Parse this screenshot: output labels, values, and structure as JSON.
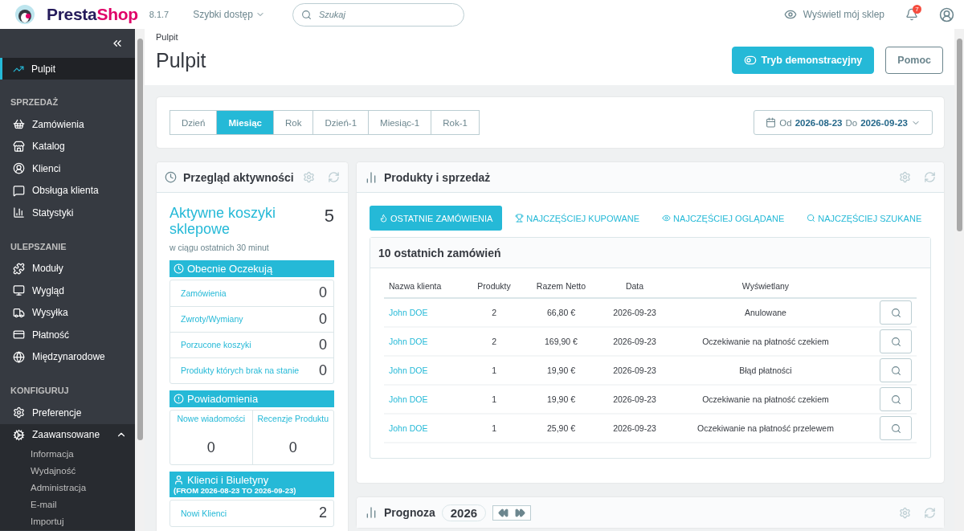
{
  "header": {
    "logo": {
      "part_1": "Presta",
      "part_2": "Shop"
    },
    "version": "8.1.7",
    "quick_access": "Szybki dostęp",
    "search": {
      "placeholder": "Szukaj"
    },
    "view_shop": "Wyświetl mój sklep",
    "notifications": "7"
  },
  "sidebar": {
    "top": {
      "label": "Pulpit",
      "selected": true
    },
    "sections": [
      {
        "title": "SPRZEDAŻ",
        "items": [
          {
            "label": "Zamówienia",
            "selected": false,
            "expanded": false
          },
          {
            "label": "Katalog",
            "selected": false,
            "expanded": false
          },
          {
            "label": "Klienci",
            "selected": false,
            "expanded": false
          },
          {
            "label": "Obsługa klienta",
            "selected": false,
            "expanded": false
          },
          {
            "label": "Statystyki",
            "selected": false,
            "expanded": false
          }
        ]
      },
      {
        "title": "ULEPSZANIE",
        "items": [
          {
            "label": "Moduły",
            "selected": false,
            "expanded": false
          },
          {
            "label": "Wygląd",
            "selected": false,
            "expanded": false
          },
          {
            "label": "Wysyłka",
            "selected": false,
            "expanded": false
          },
          {
            "label": "Płatność",
            "selected": false,
            "expanded": false
          },
          {
            "label": "Międzynarodowe",
            "selected": false,
            "expanded": false
          }
        ]
      },
      {
        "title": "KONFIGURUJ",
        "items": [
          {
            "label": "Preferencje",
            "selected": false,
            "expanded": false
          },
          {
            "label": "Zaawansowane",
            "selected": false,
            "expanded": true,
            "children": [
              {
                "label": "Informacja",
                "selected": false
              },
              {
                "label": "Wydajność",
                "selected": false
              },
              {
                "label": "Administracja",
                "selected": false
              },
              {
                "label": "E-mail",
                "selected": false
              },
              {
                "label": "Importuj",
                "selected": false
              }
            ]
          }
        ]
      }
    ]
  },
  "page": {
    "breadcrumb": "Pulpit",
    "title": "Pulpit",
    "buttons": [
      {
        "label": "Tryb demonstracyjny",
        "kind": "primary"
      },
      {
        "label": "Pomoc",
        "kind": "outline"
      }
    ]
  },
  "periods": [
    {
      "label": "Dzień",
      "selected": false
    },
    {
      "label": "Miesiąc",
      "selected": true
    },
    {
      "label": "Rok",
      "selected": false
    },
    {
      "label": "Dzień-1",
      "selected": false
    },
    {
      "label": "Miesiąc-1",
      "selected": false
    },
    {
      "label": "Rok-1",
      "selected": false
    }
  ],
  "date_range": {
    "from_label": "Od",
    "from": "2026-08-23",
    "to_label": "Do",
    "to": "2026-09-23"
  },
  "activity": {
    "title": "Przegląd aktywności",
    "carts_label": "Aktywne koszyki sklepowe",
    "carts_value": "5",
    "carts_note": "w ciągu ostatnich 30 minut",
    "sections": [
      {
        "kind": "list",
        "title": "Obecnie Oczekują",
        "rows": [
          {
            "label": "Zamówienia",
            "value": "0"
          },
          {
            "label": "Zwroty/Wymiany",
            "value": "0"
          },
          {
            "label": "Porzucone koszyki",
            "value": "0"
          },
          {
            "label": "Produkty których brak na stanie",
            "value": "0"
          }
        ]
      },
      {
        "kind": "grid",
        "title": "Powiadomienia",
        "rows": [
          {
            "label": "Nowe wiadomości",
            "value": "0"
          },
          {
            "label": "Recenzje Produktu",
            "value": "0"
          }
        ]
      },
      {
        "kind": "list",
        "title": "Klienci i Biuletyny",
        "subtitle": "(FROM 2026-08-23 TO 2026-09-23)",
        "rows": [
          {
            "label": "Nowi Klienci",
            "value": "2"
          }
        ]
      }
    ]
  },
  "products": {
    "title": "Produkty i sprzedaż",
    "tabs": [
      {
        "label": "OSTATNIE ZAMÓWIENIA",
        "selected": true
      },
      {
        "label": "NAJCZĘŚCIEJ KUPOWANE",
        "selected": false
      },
      {
        "label": "NAJCZĘŚCIEJ OGLĄDANE",
        "selected": false
      },
      {
        "label": "NAJCZĘŚCIEJ SZUKANE",
        "selected": false
      }
    ],
    "table_title": "10 ostatnich zamówień",
    "columns": [
      "Nazwa klienta",
      "Produkty",
      "Razem Netto",
      "Data",
      "Wyświetlany"
    ],
    "rows": [
      {
        "customer": "John DOE",
        "products": "2",
        "total": "66,80 €",
        "date": "2026-09-23",
        "status": "Anulowane"
      },
      {
        "customer": "John DOE",
        "products": "2",
        "total": "169,90 €",
        "date": "2026-09-23",
        "status": "Oczekiwanie na płatność czekiem"
      },
      {
        "customer": "John DOE",
        "products": "1",
        "total": "19,90 €",
        "date": "2026-09-23",
        "status": "Błąd płatności"
      },
      {
        "customer": "John DOE",
        "products": "1",
        "total": "19,90 €",
        "date": "2026-09-23",
        "status": "Oczekiwanie na płatność czekiem"
      },
      {
        "customer": "John DOE",
        "products": "1",
        "total": "25,90 €",
        "date": "2026-09-23",
        "status": "Oczekiwanie na płatność przelewem"
      }
    ]
  },
  "forecast": {
    "title": "Prognoza",
    "year": "2026"
  }
}
